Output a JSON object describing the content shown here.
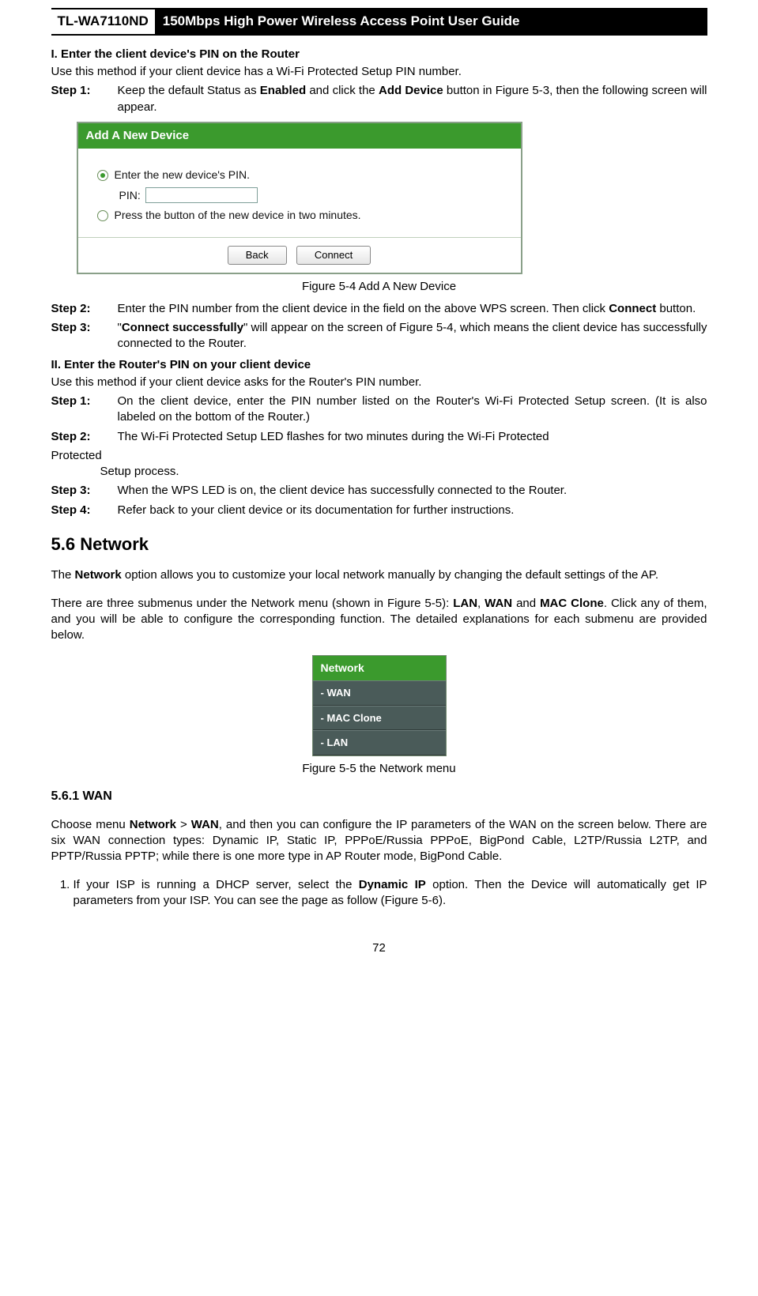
{
  "header": {
    "model": "TL-WA7110ND",
    "title": "150Mbps High Power Wireless Access Point User Guide"
  },
  "secI": {
    "heading": "I.    Enter the client device's PIN on the Router",
    "intro": "Use this method if your client device has a Wi-Fi Protected Setup PIN number.",
    "step1_label": "Step 1:",
    "step1_a": "Keep the default Status as ",
    "step1_b": "Enabled",
    "step1_c": " and click the ",
    "step1_d": "Add Device",
    "step1_e": " button in Figure 5-3, then the following screen will appear.",
    "fig54": "Figure 5-4    Add A New Device",
    "step2_label": "Step 2:",
    "step2_a": "Enter the PIN number from the client device in the field on the above WPS screen. Then click ",
    "step2_b": "Connect",
    "step2_c": " button.",
    "step3_label": "Step 3:",
    "step3_a": "\"",
    "step3_b": "Connect successfully",
    "step3_c": "\" will appear on the screen of Figure 5-4, which means the client device has successfully connected to the Router."
  },
  "panel": {
    "title": "Add A New Device",
    "opt1": "Enter the new device's PIN.",
    "pinLabel": "PIN:",
    "opt2": "Press the button of the new device in two minutes.",
    "back": "Back",
    "connect": "Connect"
  },
  "secII": {
    "heading": "II.     Enter the Router's PIN on your client device",
    "intro": "Use this method if your client device asks for the Router's PIN number.",
    "step1_label": "Step 1:",
    "step1": "On the client device, enter the PIN number listed on the Router's Wi-Fi Protected Setup screen. (It is also labeled on the bottom of the Router.)",
    "step2_label": "Step 2:",
    "step2_a": "The Wi-Fi Protected Setup LED flashes for two minutes during the Wi-Fi Protected",
    "step2_b": "Setup process.",
    "step3_label": "Step 3:",
    "step3": "When the WPS LED is on, the client device has successfully connected to the Router.",
    "step4_label": "Step 4:",
    "step4": "Refer back to your client device or its documentation for further instructions."
  },
  "net": {
    "heading": "5.6    Network",
    "p1a": "The ",
    "p1b": "Network",
    "p1c": " option allows you to customize your local network manually by changing the default settings of the AP.",
    "p2a": "There are three submenus under the Network menu (shown in Figure 5-5): ",
    "p2b": "LAN",
    "p2c": ", ",
    "p2d": "WAN",
    "p2e": " and ",
    "p2f": "MAC Clone",
    "p2g": ". Click any of them, and you will be able to configure the corresponding function.   The detailed explanations for each submenu are provided below.",
    "fig55": "Figure 5-5 the Network menu"
  },
  "menu": {
    "head": "Network",
    "i1": "- WAN",
    "i2": "- MAC Clone",
    "i3": "- LAN"
  },
  "wan": {
    "heading": "5.6.1        WAN",
    "p1a": "Choose menu ",
    "p1b": "Network",
    "p1c": " > ",
    "p1d": "WAN",
    "p1e": ", and then you can configure the IP parameters of the WAN on the screen below. There are six WAN connection types: Dynamic IP, Static IP, PPPoE/Russia PPPoE, BigPond Cable, L2TP/Russia L2TP, and PPTP/Russia PPTP; while there is one more type in AP Router mode, BigPond Cable.",
    "li1a": "If your ISP is running a DHCP server, select the ",
    "li1b": "Dynamic IP",
    "li1c": " option. Then the Device will automatically get IP parameters from your ISP. You can see the page as follow (Figure 5-6)."
  },
  "pageNum": "72"
}
